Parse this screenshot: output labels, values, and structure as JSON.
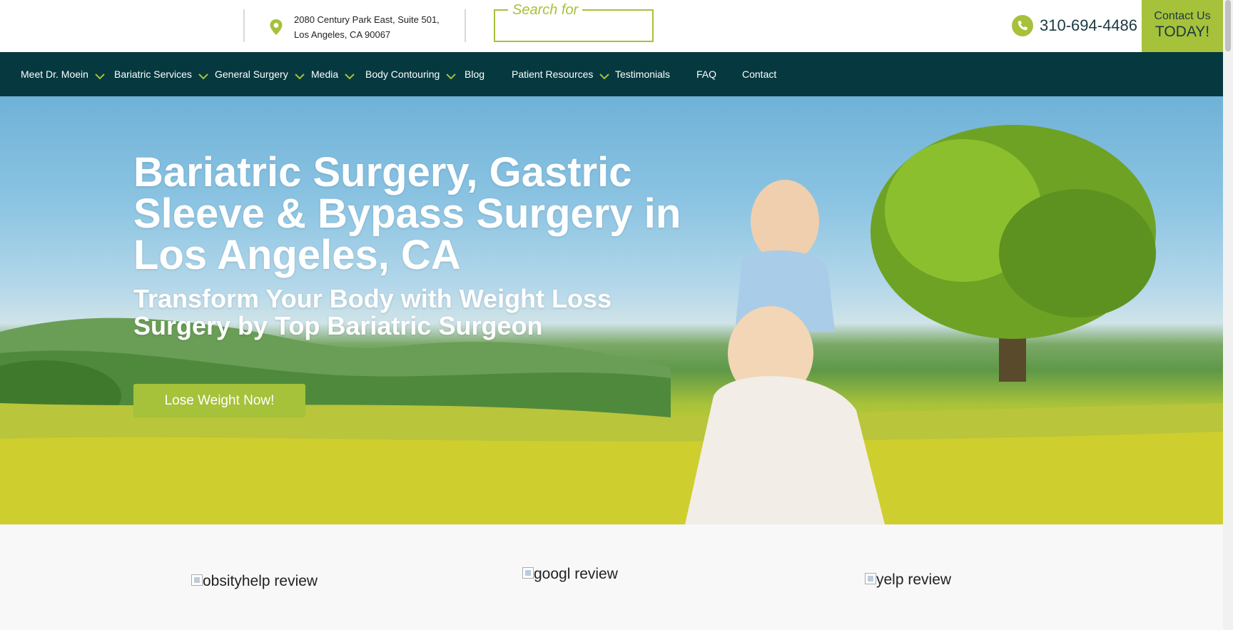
{
  "header": {
    "address_line1": "2080 Century Park East, Suite 501,",
    "address_line2": "Los Angeles, CA 90067",
    "search_placeholder": "Search for",
    "phone": "310-694-4486",
    "contact_line1": "Contact Us",
    "contact_line2": "TODAY!"
  },
  "nav": {
    "items": [
      {
        "label": "Meet Dr. Moein"
      },
      {
        "label": "Bariatric Services"
      },
      {
        "label": "General Surgery"
      },
      {
        "label": "Media"
      },
      {
        "label": "Body Contouring"
      },
      {
        "label": "Blog"
      },
      {
        "label": "Patient Resources"
      },
      {
        "label": "Testimonials"
      },
      {
        "label": "FAQ"
      },
      {
        "label": "Contact"
      }
    ]
  },
  "hero": {
    "title": "Bariatric Surgery, Gastric Sleeve & Bypass Surgery in Los Angeles, CA",
    "subtitle": "Transform Your Body with Weight Loss Surgery by Top Bariatric Surgeon",
    "cta_label": "Lose Weight Now!"
  },
  "reviews": {
    "items": [
      {
        "alt": "obsityhelp review"
      },
      {
        "alt": "googl review"
      },
      {
        "alt": "yelp review"
      }
    ]
  },
  "colors": {
    "accent": "#a6c13a",
    "nav_bg": "#05393f",
    "phone_text": "#1b3a40"
  },
  "icons": {
    "address": "map-pin-icon",
    "phone": "phone-icon",
    "nav_dropdown": "chevron-down-icon"
  }
}
